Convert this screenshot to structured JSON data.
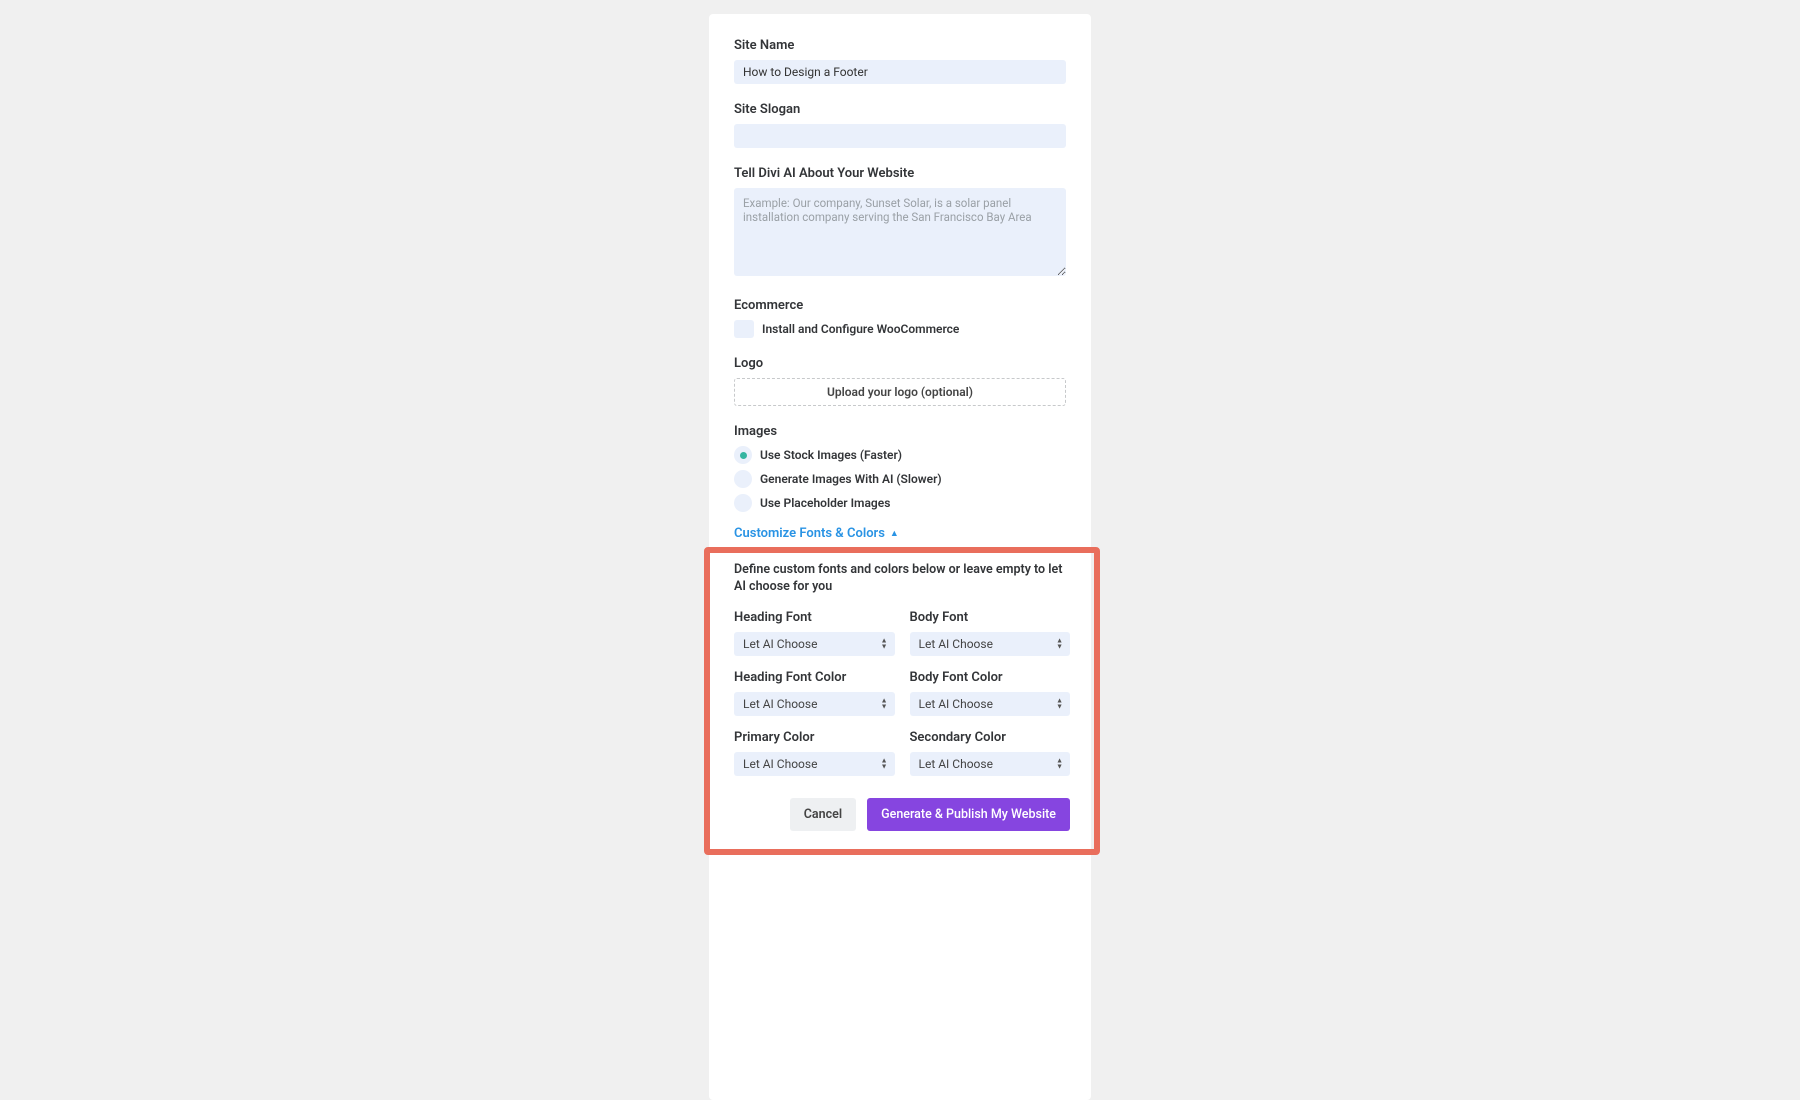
{
  "siteName": {
    "label": "Site Name",
    "value": "How to Design a Footer"
  },
  "siteSlogan": {
    "label": "Site Slogan",
    "value": ""
  },
  "about": {
    "label": "Tell Divi AI About Your Website",
    "value": "",
    "placeholder": "Example: Our company, Sunset Solar, is a solar panel installation company serving the San Francisco Bay Area"
  },
  "ecommerce": {
    "label": "Ecommerce",
    "checkbox_label": "Install and Configure WooCommerce",
    "checked": false
  },
  "logo": {
    "label": "Logo",
    "upload_text": "Upload your logo (optional)"
  },
  "images": {
    "label": "Images",
    "options": [
      {
        "label": "Use Stock Images (Faster)",
        "selected": true
      },
      {
        "label": "Generate Images With AI (Slower)",
        "selected": false
      },
      {
        "label": "Use Placeholder Images",
        "selected": false
      }
    ]
  },
  "customize_link": "Customize Fonts & Colors",
  "customize_desc": "Define custom fonts and colors below or leave empty to let AI choose for you",
  "fonts": {
    "heading_font": {
      "label": "Heading Font",
      "value": "Let AI Choose"
    },
    "body_font": {
      "label": "Body Font",
      "value": "Let AI Choose"
    },
    "heading_color": {
      "label": "Heading Font Color",
      "value": "Let AI Choose"
    },
    "body_color": {
      "label": "Body Font Color",
      "value": "Let AI Choose"
    },
    "primary_color": {
      "label": "Primary Color",
      "value": "Let AI Choose"
    },
    "secondary_color": {
      "label": "Secondary Color",
      "value": "Let AI Choose"
    }
  },
  "buttons": {
    "cancel": "Cancel",
    "generate": "Generate & Publish My Website"
  }
}
